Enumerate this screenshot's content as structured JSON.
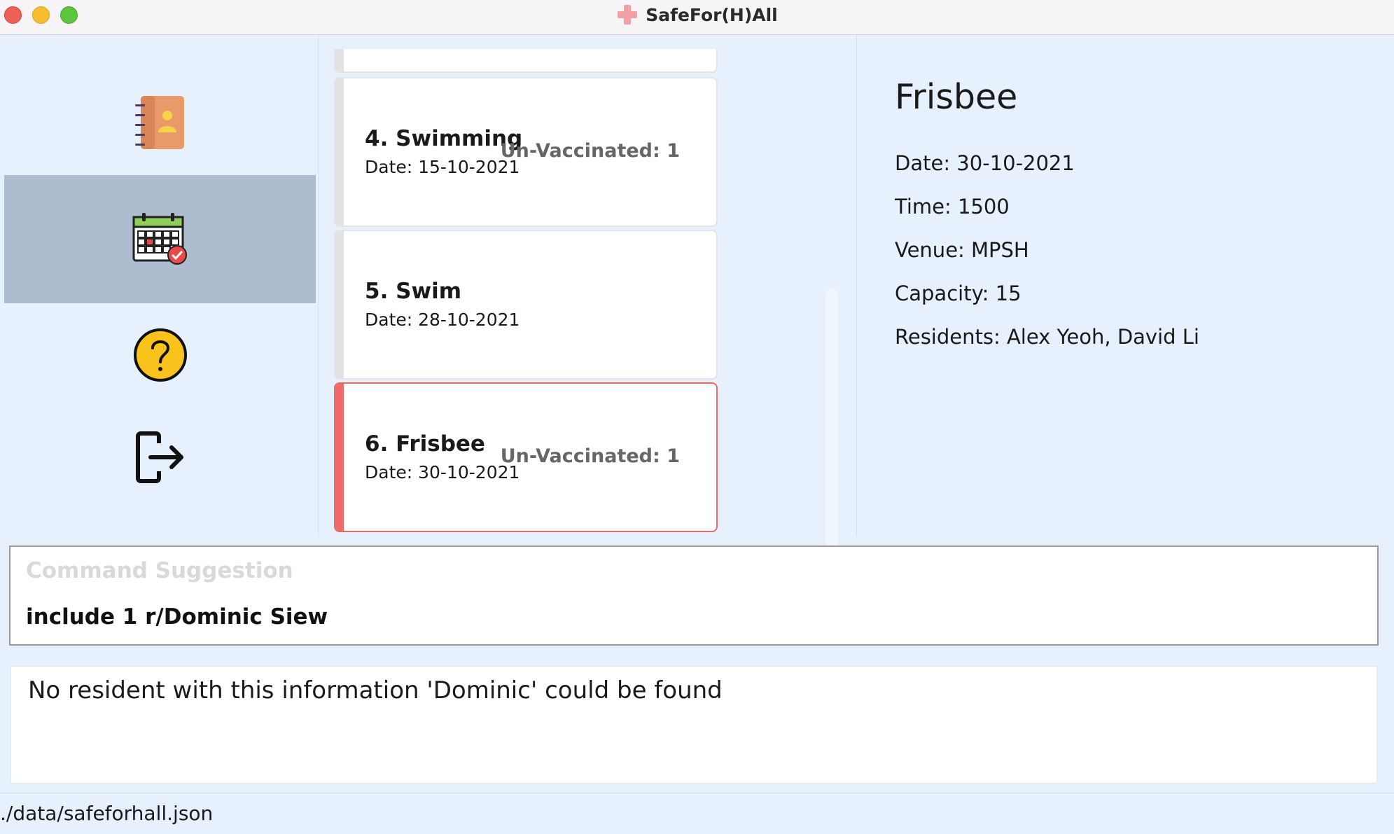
{
  "window": {
    "title": "SafeFor(H)All",
    "icon": "red-cross-icon"
  },
  "sidebar": {
    "items": [
      {
        "name": "residents",
        "icon": "address-book-icon",
        "selected": false
      },
      {
        "name": "events",
        "icon": "calendar-check-icon",
        "selected": true
      },
      {
        "name": "help",
        "icon": "question-mark-icon",
        "selected": false
      },
      {
        "name": "exit",
        "icon": "exit-icon",
        "selected": false
      }
    ]
  },
  "event_list": {
    "items": [
      {
        "name": "4.  Swimming",
        "date": "Date: 15-10-2021",
        "tag": "Un-Vaccinated: 1",
        "selected": false
      },
      {
        "name": "5.  Swim",
        "date": "Date: 28-10-2021",
        "tag": "",
        "selected": false
      },
      {
        "name": "6.  Frisbee",
        "date": "Date: 30-10-2021",
        "tag": "Un-Vaccinated: 1",
        "selected": true
      }
    ]
  },
  "details": {
    "title": "Frisbee",
    "date": "Date: 30-10-2021",
    "time": "Time: 1500",
    "venue": "Venue: MPSH",
    "capacity": "Capacity: 15",
    "residents": "Residents: Alex Yeoh, David Li"
  },
  "command": {
    "placeholder": "Command Suggestion",
    "value": "include 1 r/Dominic Siew"
  },
  "result": {
    "message": "No resident with this information 'Dominic' could be found"
  },
  "status_bar": {
    "path": "./data/safeforhall.json"
  },
  "colors": {
    "background": "#e7f1fd",
    "nav_selected": "#adbcce",
    "selected_accent": "#ef6b6b"
  }
}
